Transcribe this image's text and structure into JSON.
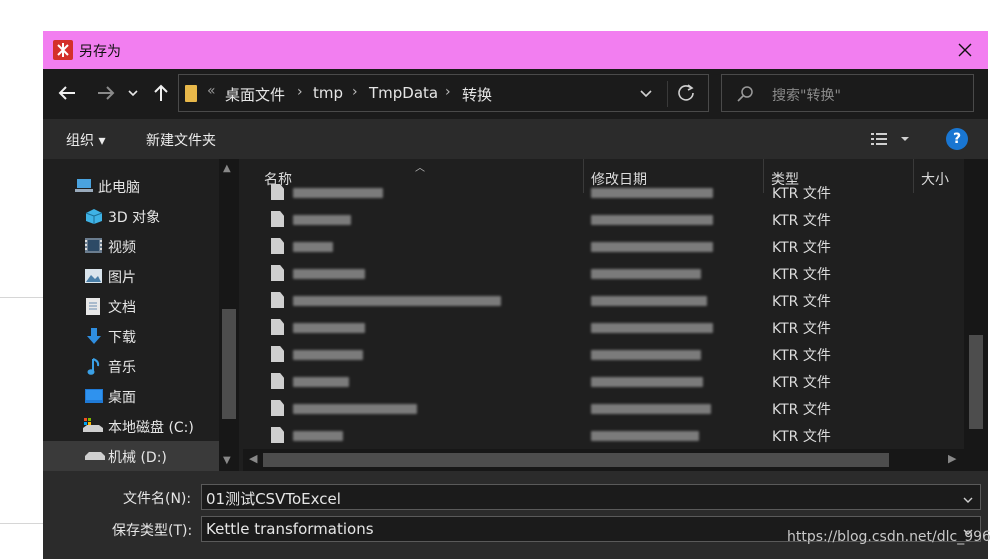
{
  "dialog": {
    "title": "另存为"
  },
  "nav": {
    "back_icon": "back-arrow-icon",
    "forward_icon": "forward-arrow-icon",
    "up_icon": "up-arrow-icon",
    "breadcrumb_overflow": "«",
    "breadcrumbs": [
      "桌面文件",
      "tmp",
      "TmpData",
      "转换"
    ],
    "search_placeholder": "搜索\"转换\""
  },
  "toolbar": {
    "organize_label": "组织 ▾",
    "new_folder_label": "新建文件夹",
    "help_label": "?"
  },
  "sidebar": {
    "items": [
      {
        "label": "此电脑",
        "icon": "computer-icon"
      },
      {
        "label": "3D 对象",
        "icon": "3d-objects-icon"
      },
      {
        "label": "视频",
        "icon": "video-icon"
      },
      {
        "label": "图片",
        "icon": "picture-icon"
      },
      {
        "label": "文档",
        "icon": "document-icon"
      },
      {
        "label": "下载",
        "icon": "download-icon"
      },
      {
        "label": "音乐",
        "icon": "music-icon"
      },
      {
        "label": "桌面",
        "icon": "desktop-icon"
      },
      {
        "label": "本地磁盘 (C:)",
        "icon": "drive-icon"
      },
      {
        "label": "机械 (D:)",
        "icon": "drive-icon"
      }
    ]
  },
  "file_list": {
    "columns": [
      "名称",
      "修改日期",
      "类型",
      "大小"
    ],
    "rows": [
      {
        "type": "KTR 文件"
      },
      {
        "type": "KTR 文件"
      },
      {
        "type": "KTR 文件"
      },
      {
        "type": "KTR 文件"
      },
      {
        "type": "KTR 文件"
      },
      {
        "type": "KTR 文件"
      },
      {
        "type": "KTR 文件"
      },
      {
        "type": "KTR 文件"
      },
      {
        "type": "KTR 文件"
      },
      {
        "type": "KTR 文件"
      }
    ]
  },
  "bottom": {
    "filename_label": "文件名(N):",
    "filename_value": "01测试CSVToExcel",
    "filetype_label": "保存类型(T):",
    "filetype_value": "Kettle transformations"
  },
  "watermark": "https://blog.csdn.net/dlc_996"
}
